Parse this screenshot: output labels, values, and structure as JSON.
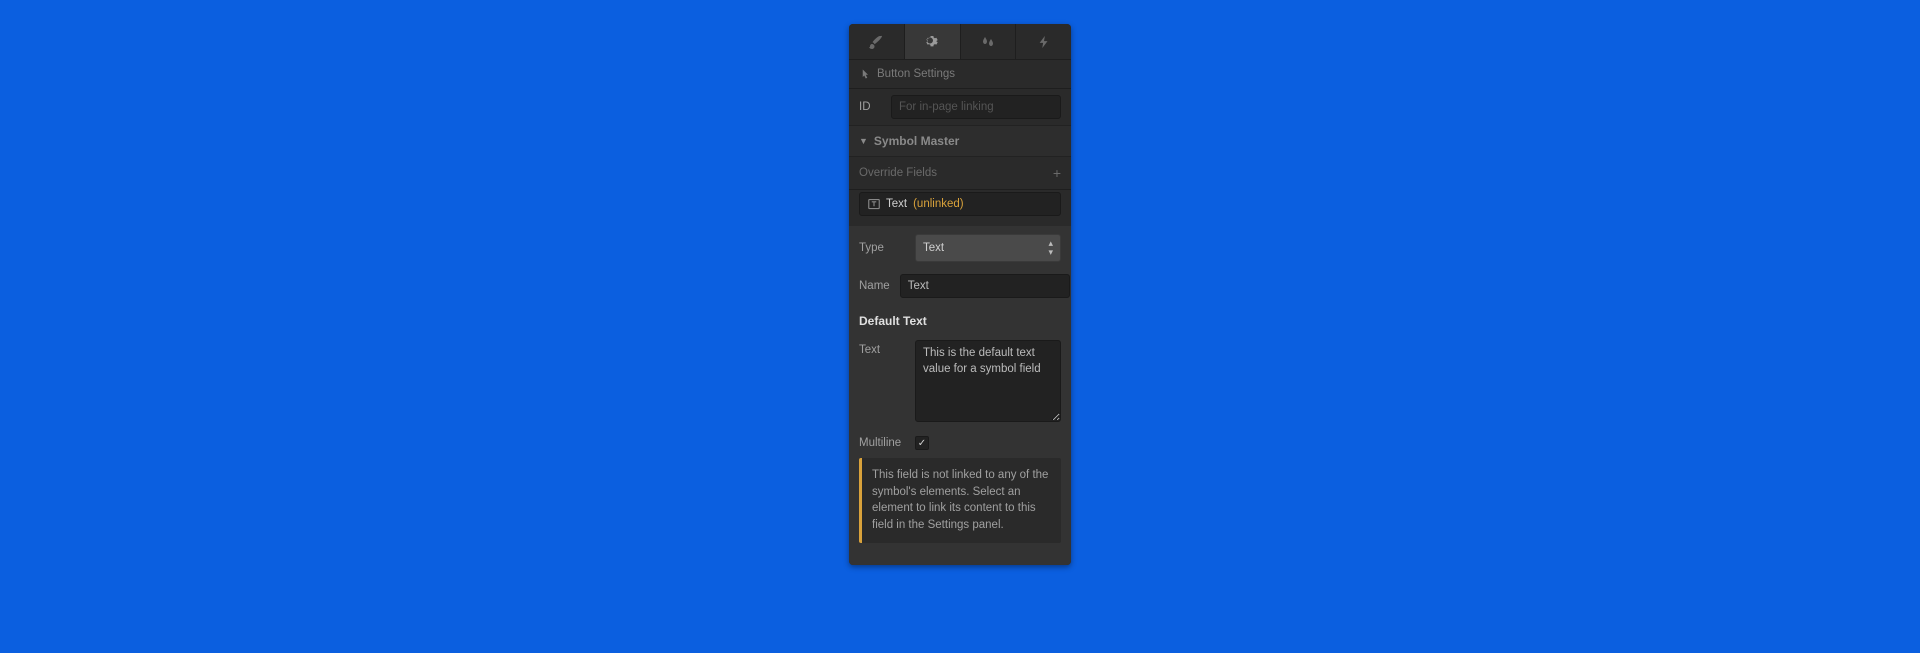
{
  "tabs": {
    "style": "style",
    "settings": "settings",
    "effects": "effects",
    "interactions": "interactions",
    "activeIndex": 1
  },
  "sections": {
    "element_settings": "Button Settings",
    "idLabel": "ID",
    "idPlaceholder": "For in-page linking",
    "symbolMaster": "Symbol Master",
    "overrideFields": "Override Fields"
  },
  "overrideField": {
    "label": "Text",
    "status": "(unlinked)"
  },
  "typeRow": {
    "label": "Type",
    "value": "Text"
  },
  "nameRow": {
    "label": "Name",
    "value": "Text"
  },
  "defaultText": {
    "title": "Default Text",
    "textLabel": "Text",
    "textValue": "This is the default text value for a symbol field",
    "multilineLabel": "Multiline",
    "multilineChecked": true
  },
  "infoBox": "This field is not linked to any of the symbol's elements. Select an element to link its content to this field in the Settings panel."
}
